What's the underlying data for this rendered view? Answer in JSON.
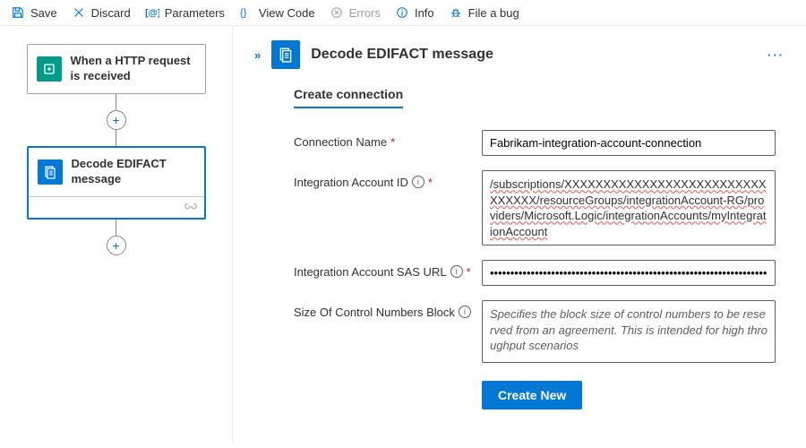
{
  "toolbar": {
    "save": "Save",
    "discard": "Discard",
    "parameters": "Parameters",
    "viewCode": "View Code",
    "errors": "Errors",
    "info": "Info",
    "fileBug": "File a bug"
  },
  "canvas": {
    "trigger": {
      "label": "When a HTTP request is received"
    },
    "action": {
      "label": "Decode EDIFACT message"
    }
  },
  "panel": {
    "title": "Decode EDIFACT message",
    "tab": "Create connection",
    "fields": {
      "connectionName": {
        "label": "Connection Name",
        "value": "Fabrikam-integration-account-connection"
      },
      "integrationAccountId": {
        "label": "Integration Account ID",
        "value": "/subscriptions/XXXXXXXXXXXXXXXXXXXXXXXXXXXXXXXX/resourceGroups/integrationAccount-RG/providers/Microsoft.Logic/integrationAccounts/myIntegrationAccount"
      },
      "sasUrl": {
        "label": "Integration Account SAS URL",
        "value": "••••••••••••••••••••••••••••••••••••••••••••••••••••••••••••••••••••••••••••••••••••••••••••••••••"
      },
      "blockSize": {
        "label": "Size Of Control Numbers Block",
        "placeholder": "Specifies the block size of control numbers to be reserved from an agreement. This is intended for high throughput scenarios"
      }
    },
    "createButton": "Create New"
  }
}
